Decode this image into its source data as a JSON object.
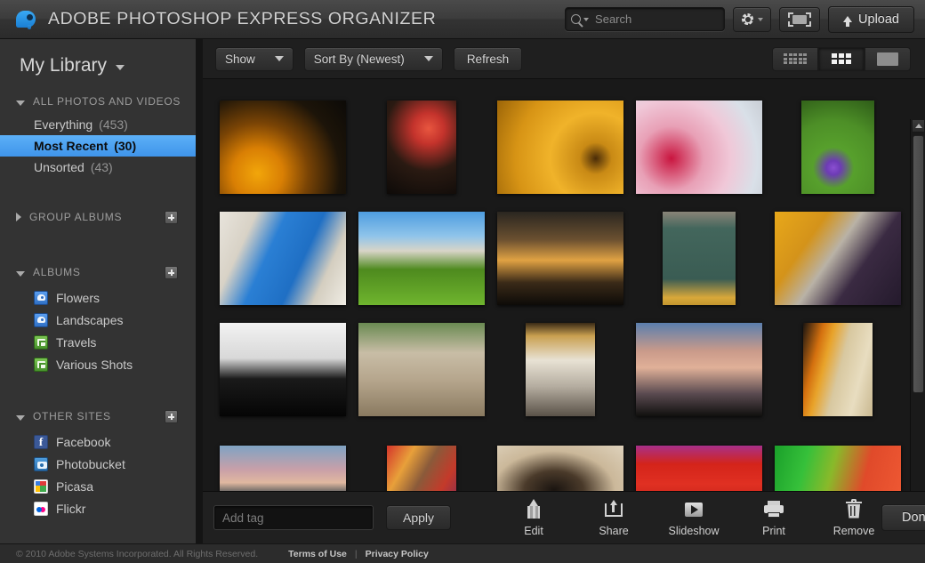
{
  "titlebar": {
    "app_title": "ADOBE PHOTOSHOP EXPRESS ORGANIZER",
    "logo_icon": "photoshop-express-drop-logo",
    "search": {
      "placeholder": "Search",
      "value": "",
      "icon": "search-icon",
      "clear_icon": "clear-x-icon",
      "dropdown_icon": "chevron-down-icon"
    },
    "settings_icon": "gear-icon",
    "fullscreen_icon": "fullscreen-icon",
    "upload_label": "Upload",
    "upload_icon": "upload-arrow-icon"
  },
  "sidebar": {
    "library_title": "My Library",
    "library_caret_icon": "chevron-down-icon",
    "sections": [
      {
        "label": "ALL PHOTOS AND VIDEOS",
        "expanded": true,
        "has_add": false,
        "items": [
          {
            "label": "Everything",
            "count": "(453)",
            "selected": false
          },
          {
            "label": "Most Recent",
            "count": "(30)",
            "selected": true
          },
          {
            "label": "Unsorted",
            "count": "(43)",
            "selected": false
          }
        ]
      },
      {
        "label": "GROUP ALBUMS",
        "expanded": false,
        "has_add": true,
        "items": []
      },
      {
        "label": "ALBUMS",
        "expanded": true,
        "has_add": true,
        "items": [
          {
            "label": "Flowers",
            "icon": "album-photo-icon"
          },
          {
            "label": "Landscapes",
            "icon": "album-photo-icon"
          },
          {
            "label": "Travels",
            "icon": "album-shared-icon"
          },
          {
            "label": "Various Shots",
            "icon": "album-shared-icon"
          }
        ]
      },
      {
        "label": "OTHER SITES",
        "expanded": true,
        "has_add": true,
        "items": [
          {
            "label": "Facebook",
            "icon": "facebook-icon"
          },
          {
            "label": "Photobucket",
            "icon": "photobucket-icon"
          },
          {
            "label": "Picasa",
            "icon": "picasa-icon"
          },
          {
            "label": "Flickr",
            "icon": "flickr-icon"
          }
        ]
      }
    ]
  },
  "toolbar": {
    "show_label": "Show",
    "sort_label": "Sort By (Newest)",
    "refresh_label": "Refresh",
    "view_modes": [
      {
        "name": "small-grid",
        "icon": "small-grid-icon",
        "active": false
      },
      {
        "name": "medium-grid",
        "icon": "medium-grid-icon",
        "active": true
      },
      {
        "name": "single-large",
        "icon": "single-large-icon",
        "active": false
      }
    ]
  },
  "gallery": {
    "thumbnails": [
      {
        "alt": "yellow-flower-closeup",
        "w": 142,
        "h": 105,
        "bg": "radial-gradient(circle at 30% 78%, #f2a60a 0%, #d97f04 22%, #7a4405 44%, #1c1409 72%, #0c0a07 100%)"
      },
      {
        "alt": "red-yellow-tulips",
        "w": 78,
        "h": 105,
        "bg": "radial-gradient(circle at 60% 30%, #e8563f 0%, #c4332c 20%, #2a1a12 55%, #0d0a08 100%), linear-gradient(to top, #4d7a22 0%, #1a1208 60%)"
      },
      {
        "alt": "orange-parasol-umbrella",
        "w": 142,
        "h": 105,
        "bg": "radial-gradient(circle at 78% 62%, #4a2c08 0%, #c98a15 14%, #f0b32a 40%, #d79415 70%, #9c6508 100%)"
      },
      {
        "alt": "pink-orchid-flower",
        "w": 142,
        "h": 105,
        "bg": "radial-gradient(circle at 28% 62%, #c9153f 0%, #e8a0b6 30%, #f0c8d8 55%, #d9e0e8 80%, #c8cdd4 100%)"
      },
      {
        "alt": "purple-water-lily",
        "w": 82,
        "h": 105,
        "bg": "radial-gradient(circle at 44% 72%, #8a4fd1 0%, #6d3bb5 9%, #57a02c 26%, #4d8f27 60%, #2e5c18 100%)"
      },
      {
        "alt": "white-arch-blue-sky",
        "w": 142,
        "h": 105,
        "bg": "linear-gradient(115deg, #e8e4dc 0%, #d8d2c6 22%, #2a7fd4 40%, #1f6fc4 62%, #d4cec0 80%, #efece4 100%)"
      },
      {
        "alt": "white-church-green-field",
        "w": 142,
        "h": 105,
        "bg": "linear-gradient(to bottom, #4e9de0 0%, #8fc4ea 26%, #d8d4c8 42%, #4e8a1e 62%, #6fb52e 100%)"
      },
      {
        "alt": "sunset-temple-silhouette",
        "w": 142,
        "h": 105,
        "bg": "linear-gradient(to bottom, #2a2620 0%, #6b5030 30%, #e0a243 52%, #3a2a18 76%, #0d0b08 100%)"
      },
      {
        "alt": "green-wooden-doorway",
        "w": 82,
        "h": 105,
        "bg": "linear-gradient(to bottom, #8a8478 0%, #43665c 18%, #3a5c53 72%, #d8a83a 92%, #c2952e 100%)"
      },
      {
        "alt": "market-vendor-with-hat",
        "w": 142,
        "h": 105,
        "bg": "linear-gradient(125deg, #e8a81a 0%, #d4931a 28%, #b9b2a6 46%, #3a2a42 66%, #241a2c 100%)"
      },
      {
        "alt": "bw-boat-silhouette-water",
        "w": 142,
        "h": 105,
        "bg": "linear-gradient(to bottom, #f2f2f2 0%, #d8d8d8 38%, #1a1a1a 60%, #050505 100%)"
      },
      {
        "alt": "old-gas-station-street",
        "w": 142,
        "h": 105,
        "bg": "linear-gradient(to bottom, #6a8a52 0%, #c8bda6 32%, #b5a58c 62%, #8a7a60 100%)"
      },
      {
        "alt": "archway-temple-view",
        "w": 78,
        "h": 105,
        "bg": "linear-gradient(to bottom, #3a2a16 0%, #c9a050 14%, #e8e2d4 40%, #b5ada0 68%, #5a5248 100%)"
      },
      {
        "alt": "dramatic-cloudscape-sunset",
        "w": 142,
        "h": 105,
        "bg": "linear-gradient(to bottom, #5b7fae 0%, #c99a8a 30%, #e0b098 48%, #5a4a50 76%, #10100e 100%)"
      },
      {
        "alt": "shoji-screen-autumn-interior",
        "w": 78,
        "h": 105,
        "bg": "linear-gradient(105deg, #1a1410 0%, #d4700f 22%, #e8a32a 34%, #d8c8a0 52%, #e8ddc0 76%, #c9b890 100%)"
      },
      {
        "alt": "coastal-sunset-trees",
        "w": 142,
        "h": 80,
        "bg": "linear-gradient(to bottom, #7fa3c4 0%, #c9a0a8 34%, #e0b8a0 52%, #2a3a44 72%, #0a0d10 100%)"
      },
      {
        "alt": "hand-on-colorful-textile",
        "w": 78,
        "h": 80,
        "bg": "linear-gradient(120deg, #d4342a 0%, #e8a03a 26%, #8a5a3a 48%, #c43a2a 72%, #7a2a5a 100%)"
      },
      {
        "alt": "pottery-wheel-hands",
        "w": 142,
        "h": 80,
        "bg": "radial-gradient(ellipse at 45% 62%, #1a1410 0%, #4a3a2a 30%, #cbb89a 62%, #ded2bc 100%)"
      },
      {
        "alt": "chinese-opera-masks-red",
        "w": 142,
        "h": 80,
        "bg": "linear-gradient(to bottom, #a8308a 0%, #d4241a 26%, #e03022 54%, #b81c14 100%)"
      },
      {
        "alt": "green-red-beads-texture",
        "w": 142,
        "h": 80,
        "bg": "linear-gradient(105deg, #1aa02a 0%, #36c03a 24%, #8ab92a 44%, #e04a2a 68%, #f05a34 100%)"
      }
    ],
    "scrollbar": {
      "up_icon": "scroll-up-arrow-icon",
      "down_icon": "scroll-down-arrow-icon"
    }
  },
  "bottombar": {
    "tag_placeholder": "Add tag",
    "tag_value": "",
    "apply_label": "Apply",
    "actions": [
      {
        "label": "Edit",
        "icon": "pencil-icon"
      },
      {
        "label": "Share",
        "icon": "share-upload-icon"
      },
      {
        "label": "Slideshow",
        "icon": "play-icon"
      },
      {
        "label": "Print",
        "icon": "printer-icon"
      },
      {
        "label": "Remove",
        "icon": "trash-icon"
      }
    ],
    "done_label": "Done"
  },
  "footer": {
    "copyright": "© 2010 Adobe Systems Incorporated. All Rights Reserved.",
    "terms_label": "Terms of Use",
    "separator": "|",
    "privacy_label": "Privacy Policy"
  }
}
